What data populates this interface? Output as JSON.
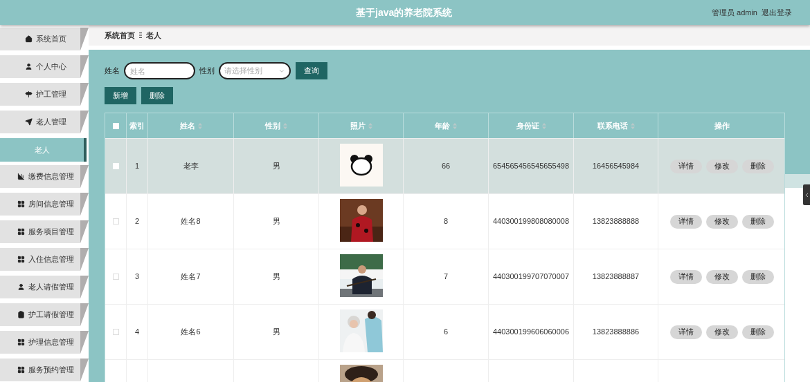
{
  "header": {
    "title": "基于java的养老院系统",
    "user": "管理员 admin",
    "logout": "退出登录"
  },
  "sidebar": {
    "items": [
      {
        "label": "系统首页",
        "kind": "home",
        "selected": false
      },
      {
        "label": "个人中心",
        "kind": "user",
        "selected": false
      },
      {
        "label": "护工管理",
        "kind": "sign",
        "selected": false
      },
      {
        "label": "老人管理",
        "kind": "send",
        "selected": false,
        "children": [
          {
            "label": "老人",
            "selected": true
          }
        ]
      },
      {
        "label": "缴费信息管理",
        "kind": "chart",
        "selected": false
      },
      {
        "label": "房间信息管理",
        "kind": "grid",
        "selected": false
      },
      {
        "label": "服务项目管理",
        "kind": "grid",
        "selected": false
      },
      {
        "label": "入住信息管理",
        "kind": "grid",
        "selected": false
      },
      {
        "label": "老人请假管理",
        "kind": "user",
        "selected": false
      },
      {
        "label": "护工请假管理",
        "kind": "clipboard",
        "selected": false
      },
      {
        "label": "护理信息管理",
        "kind": "grid",
        "selected": false
      },
      {
        "label": "服务预约管理",
        "kind": "grid",
        "selected": false
      }
    ]
  },
  "breadcrumb": [
    "系统首页",
    "老人"
  ],
  "search": {
    "fields": [
      {
        "label": "姓名",
        "placeholder": "姓名",
        "kind": "text"
      },
      {
        "label": "性别",
        "placeholder": "请选择性别",
        "kind": "select"
      }
    ],
    "button": "查询"
  },
  "actions": [
    "新增",
    "删除"
  ],
  "table": {
    "select_all": {
      "checked": false
    },
    "columns": [
      {
        "label": "索引",
        "sortable": false
      },
      {
        "label": "姓名",
        "sortable": true
      },
      {
        "label": "性别",
        "sortable": true
      },
      {
        "label": "照片",
        "sortable": true
      },
      {
        "label": "年龄",
        "sortable": true
      },
      {
        "label": "身份证",
        "sortable": true
      },
      {
        "label": "联系电话",
        "sortable": true
      },
      {
        "label": "操作",
        "sortable": false
      }
    ],
    "rows": [
      {
        "highlighted": true,
        "checked": false,
        "index": "1",
        "name": "老李",
        "gender": "男",
        "age": "66",
        "id_card": "654565456545655498",
        "phone": "16456545984",
        "buttons": [
          "详情",
          "修改",
          "删除"
        ]
      },
      {
        "highlighted": false,
        "checked": false,
        "index": "2",
        "name": "姓名8",
        "gender": "男",
        "age": "8",
        "id_card": "440300199808080008",
        "phone": "13823888888",
        "buttons": [
          "详情",
          "修改",
          "删除"
        ]
      },
      {
        "highlighted": false,
        "checked": false,
        "index": "3",
        "name": "姓名7",
        "gender": "男",
        "age": "7",
        "id_card": "440300199707070007",
        "phone": "13823888887",
        "buttons": [
          "详情",
          "修改",
          "删除"
        ]
      },
      {
        "highlighted": false,
        "checked": false,
        "index": "4",
        "name": "姓名6",
        "gender": "男",
        "age": "6",
        "id_card": "440300199606060006",
        "phone": "13823888886",
        "buttons": [
          "详情",
          "修改",
          "删除"
        ]
      },
      {
        "highlighted": false
      }
    ]
  }
}
